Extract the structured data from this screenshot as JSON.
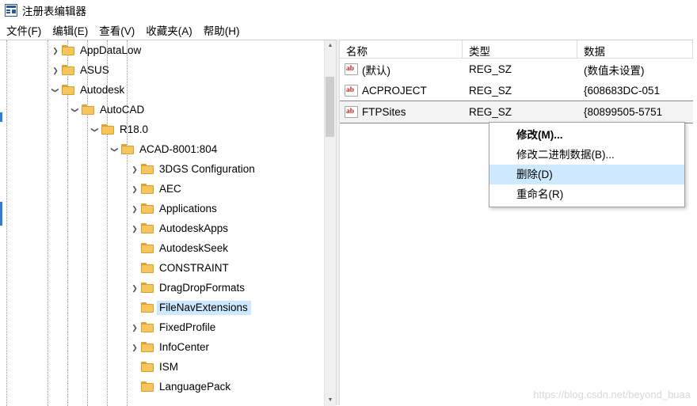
{
  "window": {
    "title": "注册表编辑器",
    "icon": "registry-editor-icon"
  },
  "menu": {
    "items": [
      {
        "label": "文件(F)",
        "name": "menu-file"
      },
      {
        "label": "编辑(E)",
        "name": "menu-edit"
      },
      {
        "label": "查看(V)",
        "name": "menu-view"
      },
      {
        "label": "收藏夹(A)",
        "name": "menu-favorites"
      },
      {
        "label": "帮助(H)",
        "name": "menu-help"
      }
    ]
  },
  "tree": {
    "nodes": [
      {
        "label": "AppDataLow",
        "indent": 1,
        "expander": "collapsed",
        "selected": false
      },
      {
        "label": "ASUS",
        "indent": 1,
        "expander": "collapsed",
        "selected": false
      },
      {
        "label": "Autodesk",
        "indent": 1,
        "expander": "expanded",
        "selected": false
      },
      {
        "label": "AutoCAD",
        "indent": 2,
        "expander": "expanded",
        "selected": false
      },
      {
        "label": "R18.0",
        "indent": 3,
        "expander": "expanded",
        "selected": false
      },
      {
        "label": "ACAD-8001:804",
        "indent": 4,
        "expander": "expanded",
        "selected": false
      },
      {
        "label": "3DGS Configuration",
        "indent": 5,
        "expander": "collapsed",
        "selected": false
      },
      {
        "label": "AEC",
        "indent": 5,
        "expander": "collapsed",
        "selected": false
      },
      {
        "label": "Applications",
        "indent": 5,
        "expander": "collapsed",
        "selected": false
      },
      {
        "label": "AutodeskApps",
        "indent": 5,
        "expander": "collapsed",
        "selected": false
      },
      {
        "label": "AutodeskSeek",
        "indent": 5,
        "expander": "none",
        "selected": false
      },
      {
        "label": "CONSTRAINT",
        "indent": 5,
        "expander": "none",
        "selected": false
      },
      {
        "label": "DragDropFormats",
        "indent": 5,
        "expander": "collapsed",
        "selected": false
      },
      {
        "label": "FileNavExtensions",
        "indent": 5,
        "expander": "none",
        "selected": true
      },
      {
        "label": "FixedProfile",
        "indent": 5,
        "expander": "collapsed",
        "selected": false
      },
      {
        "label": "InfoCenter",
        "indent": 5,
        "expander": "collapsed",
        "selected": false
      },
      {
        "label": "ISM",
        "indent": 5,
        "expander": "none",
        "selected": false
      },
      {
        "label": "LanguagePack",
        "indent": 5,
        "expander": "none",
        "selected": false
      }
    ]
  },
  "list": {
    "columns": [
      {
        "label": "名称",
        "name": "column-name"
      },
      {
        "label": "类型",
        "name": "column-type"
      },
      {
        "label": "数据",
        "name": "column-data"
      }
    ],
    "rows": [
      {
        "name": "(默认)",
        "type": "REG_SZ",
        "data": "(数值未设置)",
        "selected": false
      },
      {
        "name": "ACPROJECT",
        "type": "REG_SZ",
        "data": "{608683DC-051",
        "selected": false
      },
      {
        "name": "FTPSites",
        "type": "REG_SZ",
        "data": "{80899505-5751",
        "selected": true
      }
    ]
  },
  "context_menu": {
    "items": [
      {
        "label": "修改(M)...",
        "name": "context-modify",
        "bold": true,
        "highlight": false
      },
      {
        "label": "修改二进制数据(B)...",
        "name": "context-modify-binary",
        "bold": false,
        "highlight": false
      },
      {
        "label": "删除(D)",
        "name": "context-delete",
        "bold": false,
        "highlight": true
      },
      {
        "label": "重命名(R)",
        "name": "context-rename",
        "bold": false,
        "highlight": false
      }
    ]
  },
  "watermark": {
    "text": "https://blog.csdn.net/beyond_buaa"
  },
  "colors": {
    "selection": "#cde8ff",
    "folder": "#f6c65c",
    "accent": "#2b579a"
  }
}
